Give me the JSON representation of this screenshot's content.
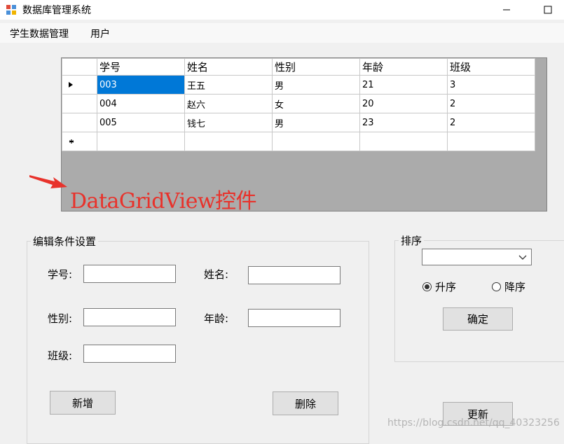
{
  "window": {
    "title": "数据库管理系统"
  },
  "menu": {
    "items": [
      "学生数据管理",
      "用户"
    ]
  },
  "grid": {
    "columns": [
      "学号",
      "姓名",
      "性别",
      "年龄",
      "班级"
    ],
    "rows": [
      [
        "003",
        "王五",
        "男",
        "21",
        "3"
      ],
      [
        "004",
        "赵六",
        "女",
        "20",
        "2"
      ],
      [
        "005",
        "钱七",
        "男",
        "23",
        "2"
      ]
    ]
  },
  "annotation": {
    "text": "DataGridView控件",
    "color": "#e8322b"
  },
  "edit": {
    "title": "编辑条件设置",
    "id_label": "学号:",
    "name_label": "姓名:",
    "gender_label": "性别:",
    "age_label": "年龄:",
    "class_label": "班级:",
    "add_label": "新增",
    "delete_label": "删除"
  },
  "sort": {
    "title": "排序",
    "asc_label": "升序",
    "desc_label": "降序",
    "asc_checked": true,
    "confirm_label": "确定"
  },
  "update_label": "更新",
  "watermark": "https://blog.csdn.net/qq_40323256"
}
